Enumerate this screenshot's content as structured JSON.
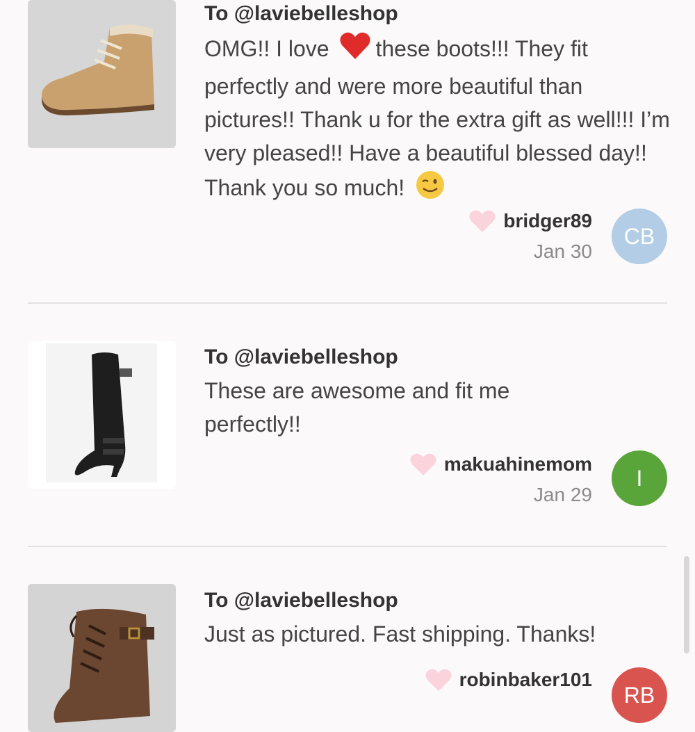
{
  "reviews": [
    {
      "to": "To @laviebelleshop",
      "message_part1": "OMG!! I love",
      "message_part2": "these boots!!! They fit perfectly and were more beautiful than pictures!! Thank u for the extra gift as well!!! I’m very pleased!! Have a beautiful blessed day!! Thank you so much!",
      "username": "bridger89",
      "date": "Jan 30",
      "avatar_initials": "CB",
      "avatar_color": "#b3cde6",
      "image_icon": "tan-lace-up-ankle-boot"
    },
    {
      "to": "To @laviebelleshop",
      "message": "These are awesome and fit me perfectly!!",
      "username": "makuahinemom",
      "date": "Jan 29",
      "avatar_initials": "I",
      "avatar_color": "#5aa53a",
      "image_icon": "black-knee-high-heeled-boot"
    },
    {
      "to": "To @laviebelleshop",
      "message": "Just as pictured. Fast shipping. Thanks!",
      "username": "robinbaker101",
      "avatar_initials": "RB",
      "avatar_color": "#d9544f",
      "image_icon": "brown-lace-up-combat-boot"
    }
  ],
  "colors": {
    "heart": "#fbd3dc",
    "divider": "#e3e1e2"
  }
}
